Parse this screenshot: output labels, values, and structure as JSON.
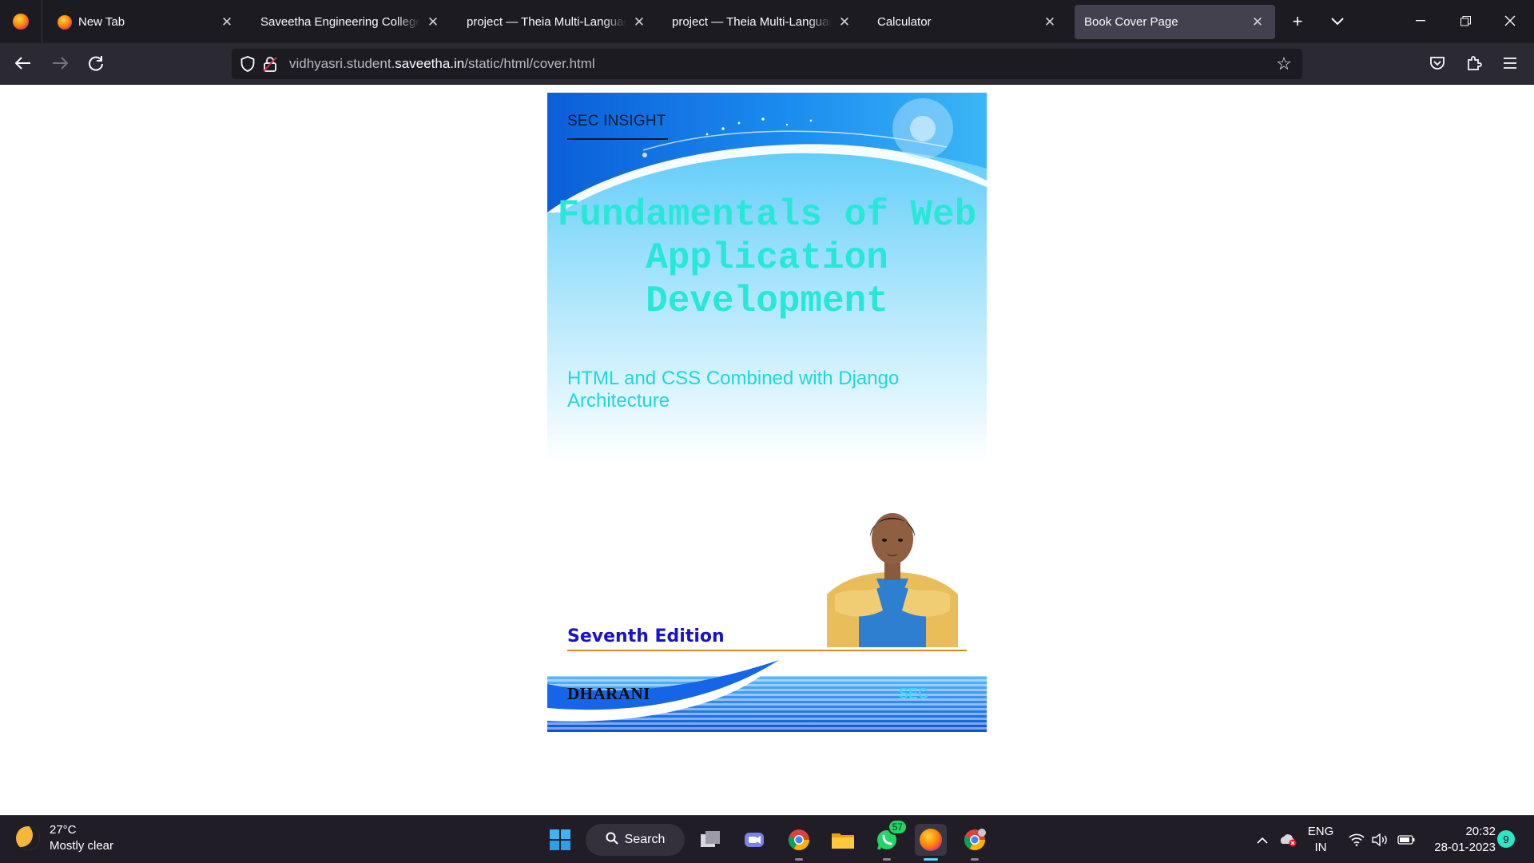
{
  "browser": {
    "tabs": [
      {
        "title": "New Tab",
        "active": false,
        "has_favicon": true
      },
      {
        "title": "Saveetha Engineering College",
        "active": false,
        "has_favicon": false
      },
      {
        "title": "project — Theia Multi-Language",
        "active": false,
        "has_favicon": false
      },
      {
        "title": "project — Theia Multi-Language",
        "active": false,
        "has_favicon": false
      },
      {
        "title": "Calculator",
        "active": false,
        "has_favicon": false
      },
      {
        "title": "Book Cover Page",
        "active": true,
        "has_favicon": false
      }
    ],
    "new_tab_icon": "plus-icon",
    "tab_list_icon": "chevron-down-icon",
    "url": {
      "prefix": "vidhyasri.student.",
      "host": "saveetha.in",
      "path": "/static/html/cover.html"
    }
  },
  "cover": {
    "series_label": "SEC INSIGHT",
    "title": "Fundamentals of Web Application Development",
    "subtitle": "HTML and CSS Combined with Django Architecture",
    "edition": "Seventh Edition",
    "author": "DHARANI",
    "publisher_mark": "SEC"
  },
  "taskbar": {
    "weather": {
      "temp": "27°C",
      "condition": "Mostly clear"
    },
    "search_label": "Search",
    "whatsapp_badge": "57",
    "language": {
      "line1": "ENG",
      "line2": "IN"
    },
    "clock": {
      "time": "20:32",
      "date": "28-01-2023"
    },
    "notification_count": "9"
  },
  "colors": {
    "title": "#27e8d8",
    "subtitle": "#1ed7dd",
    "edition": "#1a12c9",
    "edition_rule": "#d58a1f",
    "cover_top": "#43c2f7"
  }
}
